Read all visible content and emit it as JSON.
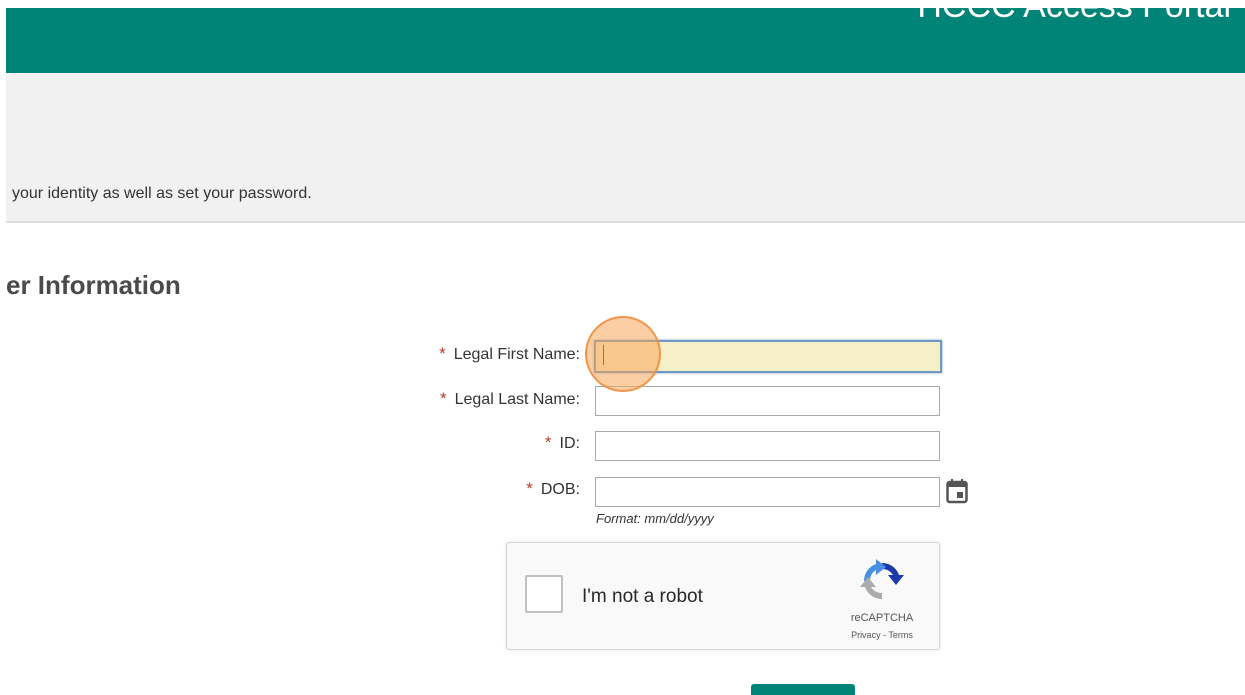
{
  "header": {
    "title": "HCCC Access Portal"
  },
  "intro": {
    "text": "your identity as well as set your password."
  },
  "section": {
    "heading": "er Information"
  },
  "form": {
    "required_marker": "*",
    "fields": [
      {
        "label": "Legal First Name:",
        "value": "",
        "focused": true
      },
      {
        "label": "Legal Last Name:",
        "value": ""
      },
      {
        "label": "ID:",
        "value": ""
      },
      {
        "label": "DOB:",
        "value": "",
        "icon": "calendar-icon"
      }
    ],
    "dob_format_hint": "Format: mm/dd/yyyy"
  },
  "recaptcha": {
    "label": "I'm not a robot",
    "brand": "reCAPTCHA",
    "privacy": "Privacy",
    "separator": " - ",
    "terms": "Terms",
    "checked": false
  },
  "colors": {
    "brand_green": "#008478",
    "focus_fill": "#f5f0c7",
    "required_red": "#c0392b",
    "click_indicator": "#f8a65a"
  }
}
